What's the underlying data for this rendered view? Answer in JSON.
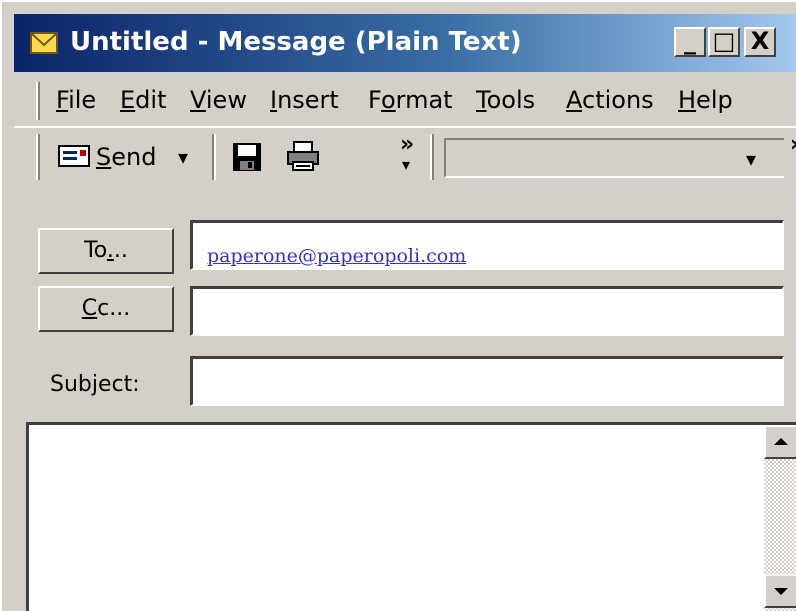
{
  "window": {
    "title": "Untitled - Message (Plain Text)",
    "controls": {
      "minimize": "_",
      "maximize": "□",
      "close": "X"
    }
  },
  "menu": [
    {
      "label": "File",
      "accel": "F",
      "rest": "ile"
    },
    {
      "label": "Edit",
      "accel": "E",
      "rest": "dit"
    },
    {
      "label": "View",
      "accel": "V",
      "rest": "iew"
    },
    {
      "label": "Insert",
      "accel": "I",
      "rest": "nsert"
    },
    {
      "label": "Format",
      "pre": "F",
      "accel": "o",
      "rest": "rmat"
    },
    {
      "label": "Tools",
      "accel": "T",
      "rest": "ools"
    },
    {
      "label": "Actions",
      "accel": "A",
      "rest": "ctions"
    },
    {
      "label": "Help",
      "accel": "H",
      "rest": "elp"
    }
  ],
  "toolbar": {
    "send": {
      "accel": "S",
      "rest": "end",
      "dropdown": "▾"
    },
    "overflow": "»",
    "overflow_arrow": "▾",
    "combo_arrow": "▾",
    "icons": [
      "send-envelope-icon",
      "save-disk-icon",
      "print-icon"
    ]
  },
  "fields": {
    "to": {
      "button": {
        "pre": "To",
        "accel": ".",
        "rest": ".."
      },
      "value": "paperone@paperopoli.com"
    },
    "cc": {
      "button": {
        "accel": "C",
        "rest": "c..."
      },
      "value": ""
    },
    "subject": {
      "label_pre": "Sub",
      "accel": "j",
      "label_rest": "ect:",
      "value": ""
    }
  },
  "body": {
    "text": ""
  },
  "colors": {
    "titlebar_start": "#0a246a",
    "titlebar_end": "#a6caf0",
    "face": "#d4d0c8",
    "link": "#3333cc"
  }
}
